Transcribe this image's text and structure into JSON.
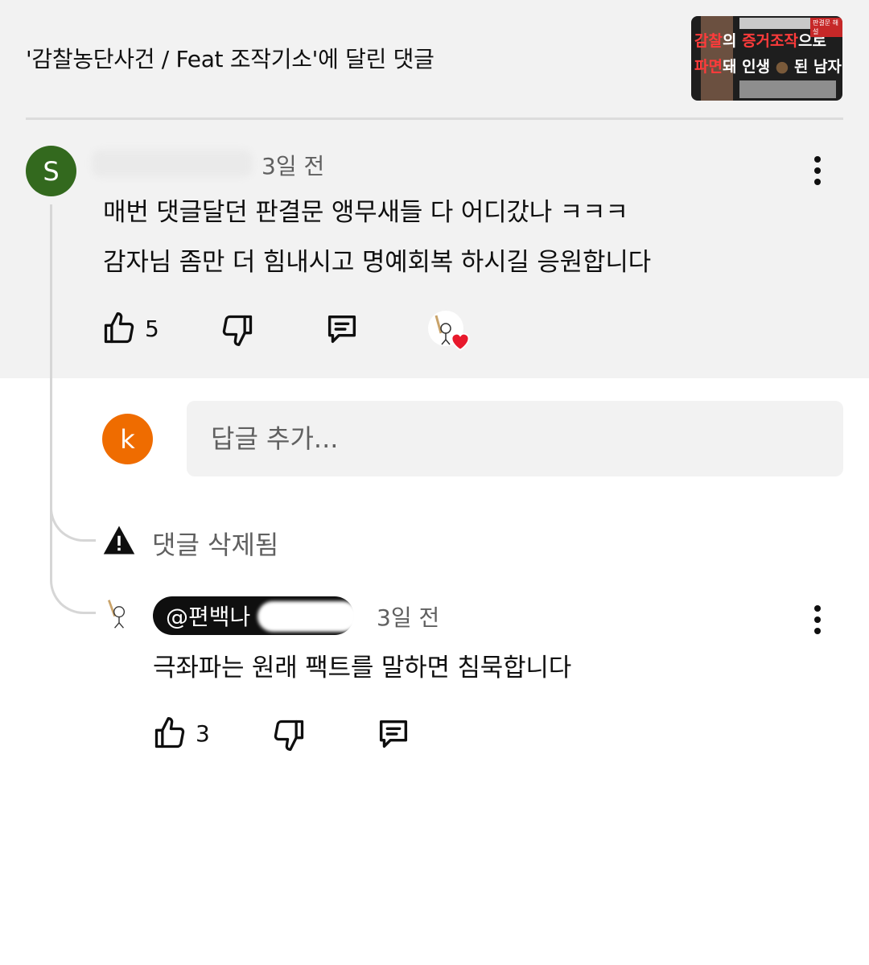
{
  "header": {
    "title": "'감찰농단사건 / Feat 조작기소'에 달린 댓글",
    "thumbnail": {
      "line1": [
        "감찰",
        "의 ",
        "증거조작",
        "으로"
      ],
      "line2": [
        "파면",
        "돼 인생 ",
        "●",
        " 된 남자"
      ],
      "tag": "판결문 해설"
    }
  },
  "comment": {
    "avatar_letter": "S",
    "avatar_color": "#33691e",
    "time": "3일 전",
    "lines": [
      "매번 댓글달던 판결문 앵무새들 다 어디갔나  ㅋㅋㅋ",
      "감자님 좀만 더 힘내시고 명예회복 하시길 응원합니다"
    ],
    "likes": "5"
  },
  "reply_box": {
    "avatar_letter": "k",
    "avatar_color": "#ef6c00",
    "placeholder": "답글 추가..."
  },
  "deleted": {
    "text": "댓글 삭제됨"
  },
  "reply": {
    "handle": "@편백나",
    "time": "3일 전",
    "text": "극좌파는 원래 팩트를 말하면 침묵합니다",
    "likes": "3"
  },
  "colors": {
    "top_background": "#f2f2f2",
    "heart": "#e8192c"
  },
  "icons": [
    "thumbs-up-icon",
    "thumbs-down-icon",
    "comment-icon",
    "warning-icon",
    "more-vert-icon",
    "heart-icon"
  ]
}
